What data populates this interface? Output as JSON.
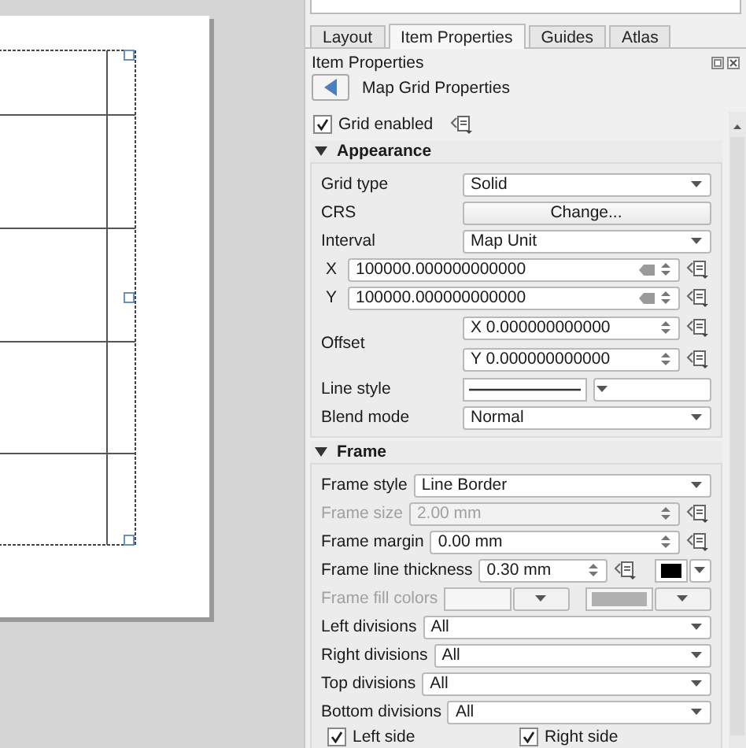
{
  "tabs": [
    {
      "label": "Layout",
      "selected": false
    },
    {
      "label": "Item Properties",
      "selected": true
    },
    {
      "label": "Guides",
      "selected": false
    },
    {
      "label": "Atlas",
      "selected": false
    }
  ],
  "dock": {
    "title": "Item Properties",
    "subtitle": "Map Grid Properties"
  },
  "grid_enabled": {
    "label": "Grid enabled",
    "checked": true
  },
  "sections": [
    {
      "title": "Appearance",
      "expanded": true,
      "rows": [
        {
          "kind": "dropdown",
          "label": "Grid type",
          "value": "Solid",
          "disabled": false
        },
        {
          "kind": "button",
          "label": "CRS",
          "value": "Change...",
          "disabled": false
        },
        {
          "kind": "dropdown",
          "label": "Interval",
          "value": "Map Unit",
          "disabled": false
        },
        {
          "kind": "axis",
          "label": "X",
          "value": "100000.000000000000",
          "disabled": false
        },
        {
          "kind": "axis",
          "label": "Y",
          "value": "100000.000000000000",
          "disabled": false
        },
        {
          "kind": "pair",
          "label": "Offset",
          "values": [
            "X 0.000000000000",
            "Y 0.000000000000"
          ],
          "disabled": false
        },
        {
          "kind": "linestyle",
          "label": "Line style",
          "disabled": false
        },
        {
          "kind": "dropdown",
          "label": "Blend mode",
          "value": "Normal",
          "disabled": false
        }
      ]
    },
    {
      "title": "Frame",
      "expanded": true,
      "rows": [
        {
          "kind": "dropdown",
          "label": "Frame style",
          "value": "Line Border",
          "disabled": false
        },
        {
          "kind": "spin",
          "label": "Frame size",
          "value": "2.00 mm",
          "disabled": true
        },
        {
          "kind": "spin",
          "label": "Frame margin",
          "value": "0.00 mm",
          "disabled": false
        },
        {
          "kind": "spincolor",
          "label": "Frame line thickness",
          "value": "0.30 mm",
          "color": "#000000",
          "disabled": false
        },
        {
          "kind": "colorpair",
          "label": "Frame fill colors",
          "disabled": true
        },
        {
          "kind": "dropdown",
          "label": "Left divisions",
          "value": "All",
          "disabled": false
        },
        {
          "kind": "dropdown",
          "label": "Right divisions",
          "value": "All",
          "disabled": false
        },
        {
          "kind": "dropdown",
          "label": "Top divisions",
          "value": "All",
          "disabled": false
        },
        {
          "kind": "dropdown",
          "label": "Bottom divisions",
          "value": "All",
          "disabled": false
        },
        {
          "kind": "checks",
          "items": [
            {
              "label": "Left side",
              "checked": true
            },
            {
              "label": "Right side",
              "checked": true
            }
          ]
        }
      ]
    }
  ]
}
